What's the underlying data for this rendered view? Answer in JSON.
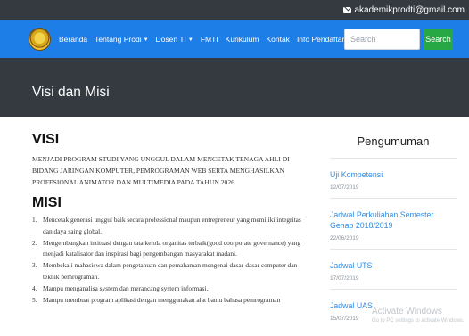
{
  "topbar": {
    "email": "akademikprodti@gmail.com",
    "email_icon": "envelope-icon"
  },
  "nav": {
    "logo": "university-seal-logo",
    "items": [
      {
        "label": "Beranda",
        "dropdown": false
      },
      {
        "label": "Tentang Prodi",
        "dropdown": true
      },
      {
        "label": "Dosen TI",
        "dropdown": true
      },
      {
        "label": "FMTI",
        "dropdown": false
      },
      {
        "label": "Kurikulum",
        "dropdown": false
      },
      {
        "label": "Kontak",
        "dropdown": false
      },
      {
        "label": "Info Pendaftaran",
        "dropdown": false
      }
    ],
    "search_placeholder": "Search",
    "search_button": "Search"
  },
  "header": {
    "title": "Visi dan Misi"
  },
  "visi": {
    "heading": "VISI",
    "text": "MENJADI PROGRAM STUDI YANG UNGGUL DALAM MENCETAK TENAGA AHLI DI BIDANG JARINGAN KOMPUTER, PEMROGRAMAN WEB SERTA MENGHASILKAN PROFESIONAL ANIMATOR DAN MULTIMEDIA PADA TAHUN 2026"
  },
  "misi": {
    "heading": "MISI",
    "items": [
      {
        "num": "1.",
        "text": "Mencetak generasi unggul baik secara professional maupun entrepreneur yang memiliki integritas dan daya saing global."
      },
      {
        "num": "2.",
        "text": "Mengembangkan intituasi dengan tata kelola organitas terbaik(good coorporate governance) yang menjadi katalisator dan inspirasi bagi pengembangan masyarakat madani."
      },
      {
        "num": "3.",
        "text": "Membekali mahasiswa dalam pengetahuan dan pemahaman mengenai dasar-dasar computer dan teknik pemrograman."
      },
      {
        "num": "4.",
        "text": "Mampu menganalisa system dan merancang system informasi."
      },
      {
        "num": "5.",
        "text": "Mampu membuat program aplikasi dengan menggunakan alat bantu bahasa pemrograman"
      }
    ]
  },
  "sidebar": {
    "title": "Pengumuman",
    "announcements": [
      {
        "title": "Uji Kompetensi",
        "date": "12/07/2019"
      },
      {
        "title": "Jadwal Perkuliahan Semester Genap 2018/2019",
        "date": "22/06/2019"
      },
      {
        "title": "Jadwal UTS",
        "date": "17/07/2019"
      },
      {
        "title": "Jadwal UAS",
        "date": "15/07/2019"
      }
    ]
  },
  "watermark": {
    "line1": "Activate Windows",
    "line2": "Go to PC settings to activate Windows."
  },
  "colors": {
    "nav": "#1e7ee8",
    "dark": "#343a40",
    "link": "#2f8be6",
    "search_button": "#28a745"
  }
}
